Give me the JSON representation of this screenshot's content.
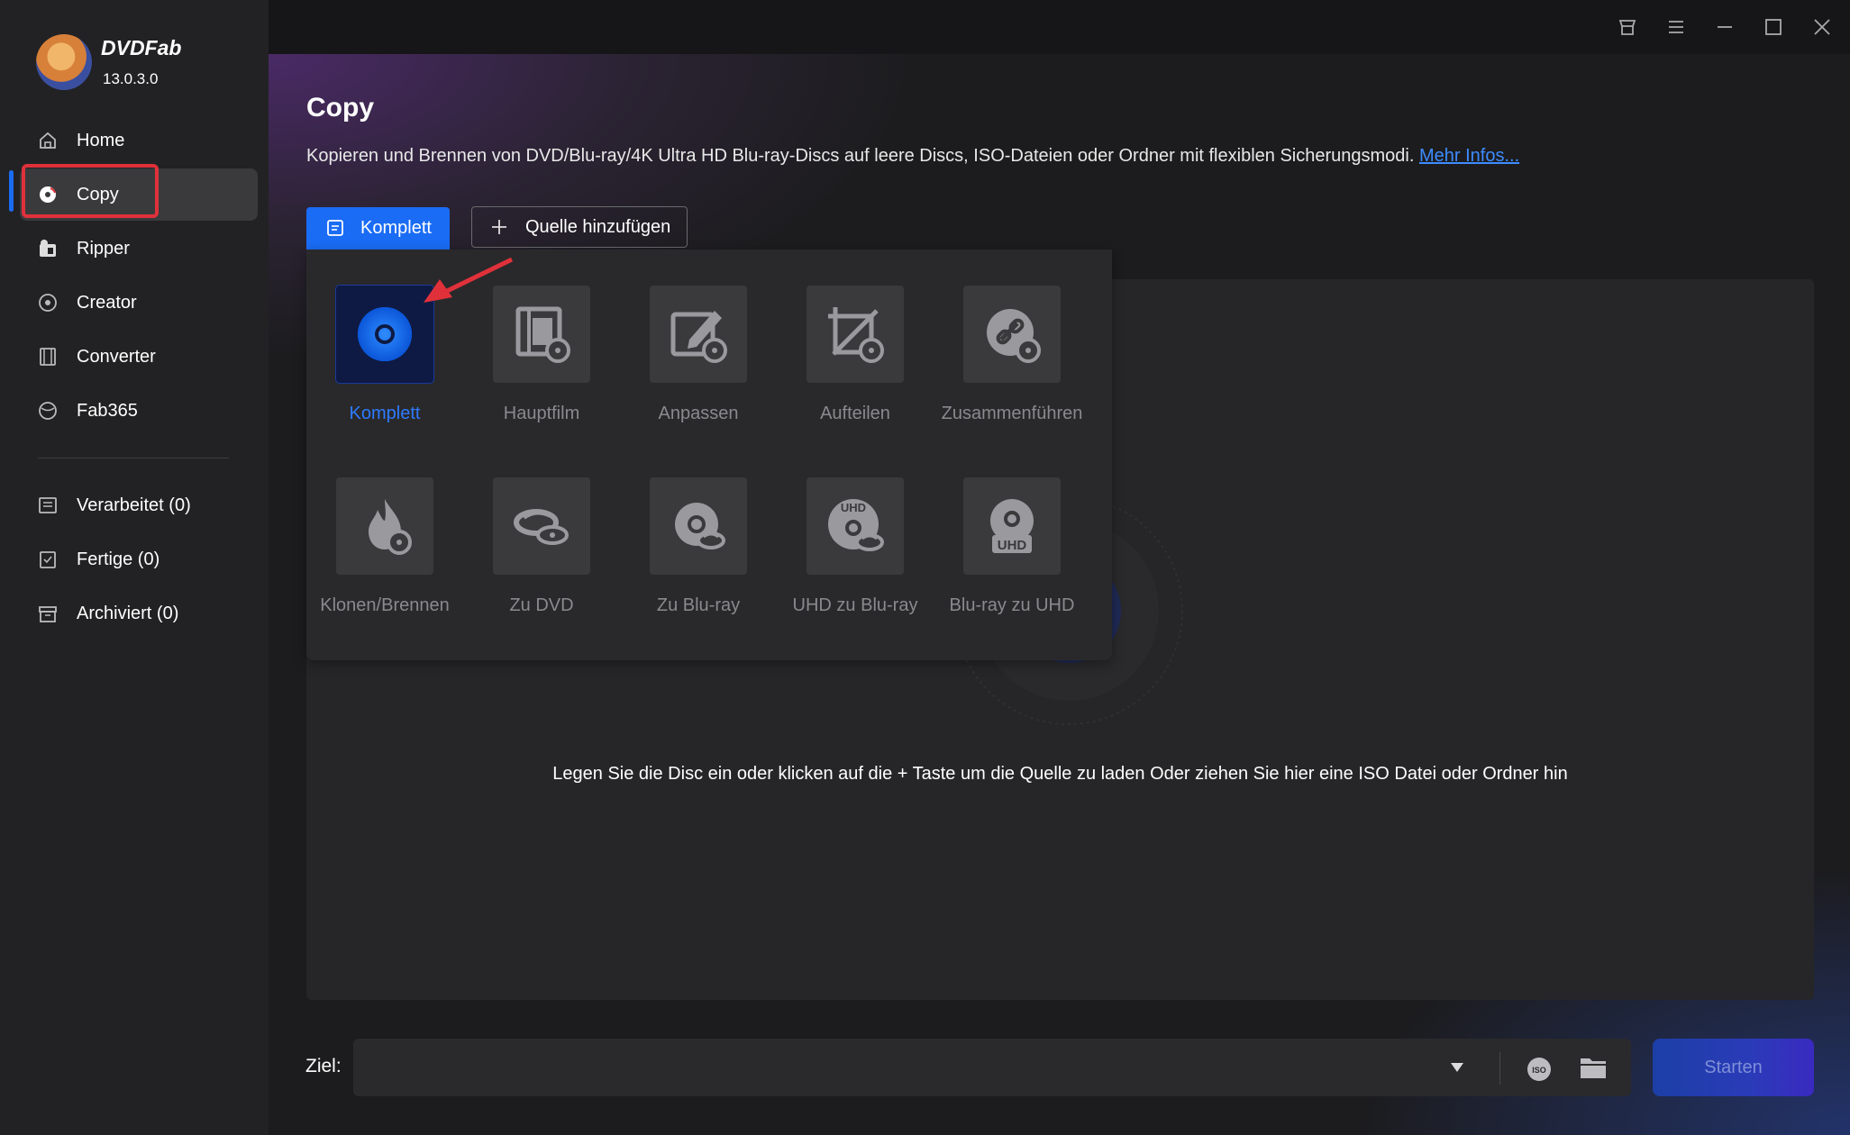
{
  "app": {
    "brand": "DVDFab",
    "version": "13.0.3.0"
  },
  "sidebar": {
    "items": [
      {
        "label": "Home"
      },
      {
        "label": "Copy"
      },
      {
        "label": "Ripper"
      },
      {
        "label": "Creator"
      },
      {
        "label": "Converter"
      },
      {
        "label": "Fab365"
      }
    ],
    "task_items": [
      {
        "label": "Verarbeitet (0)"
      },
      {
        "label": "Fertige (0)"
      },
      {
        "label": "Archiviert (0)"
      }
    ]
  },
  "main": {
    "title": "Copy",
    "description": "Kopieren und Brennen von DVD/Blu-ray/4K Ultra HD Blu-ray-Discs auf leere Discs, ISO-Dateien oder Ordner mit flexiblen Sicherungsmodi.",
    "more_link": "Mehr Infos...",
    "mode_button": "Komplett",
    "add_source_button": "Quelle hinzufügen",
    "drop_hint": "Legen Sie die Disc ein oder klicken auf die + Taste um die Quelle zu laden Oder ziehen Sie hier eine ISO Datei oder Ordner hin",
    "modes": [
      {
        "label": "Komplett",
        "icon": "disc-icon",
        "selected": true
      },
      {
        "label": "Hauptfilm",
        "icon": "film-disc-icon"
      },
      {
        "label": "Anpassen",
        "icon": "edit-disc-icon"
      },
      {
        "label": "Aufteilen",
        "icon": "split-disc-icon"
      },
      {
        "label": "Zusammenführen",
        "icon": "merge-disc-icon"
      },
      {
        "label": "Klonen/Brennen",
        "icon": "fire-disc-icon"
      },
      {
        "label": "Zu DVD",
        "icon": "bluray-to-dvd-icon"
      },
      {
        "label": "Zu Blu-ray",
        "icon": "dvd-to-bluray-icon"
      },
      {
        "label": "UHD zu Blu-ray",
        "icon": "uhd-to-bluray-icon"
      },
      {
        "label": "Blu-ray zu UHD",
        "icon": "bluray-to-uhd-icon"
      }
    ]
  },
  "footer": {
    "target_label": "Ziel:",
    "target_value": "",
    "start_button": "Starten"
  },
  "colors": {
    "accent": "#1a6cf5",
    "highlight_box": "#e0313b",
    "link": "#3d8cff"
  }
}
